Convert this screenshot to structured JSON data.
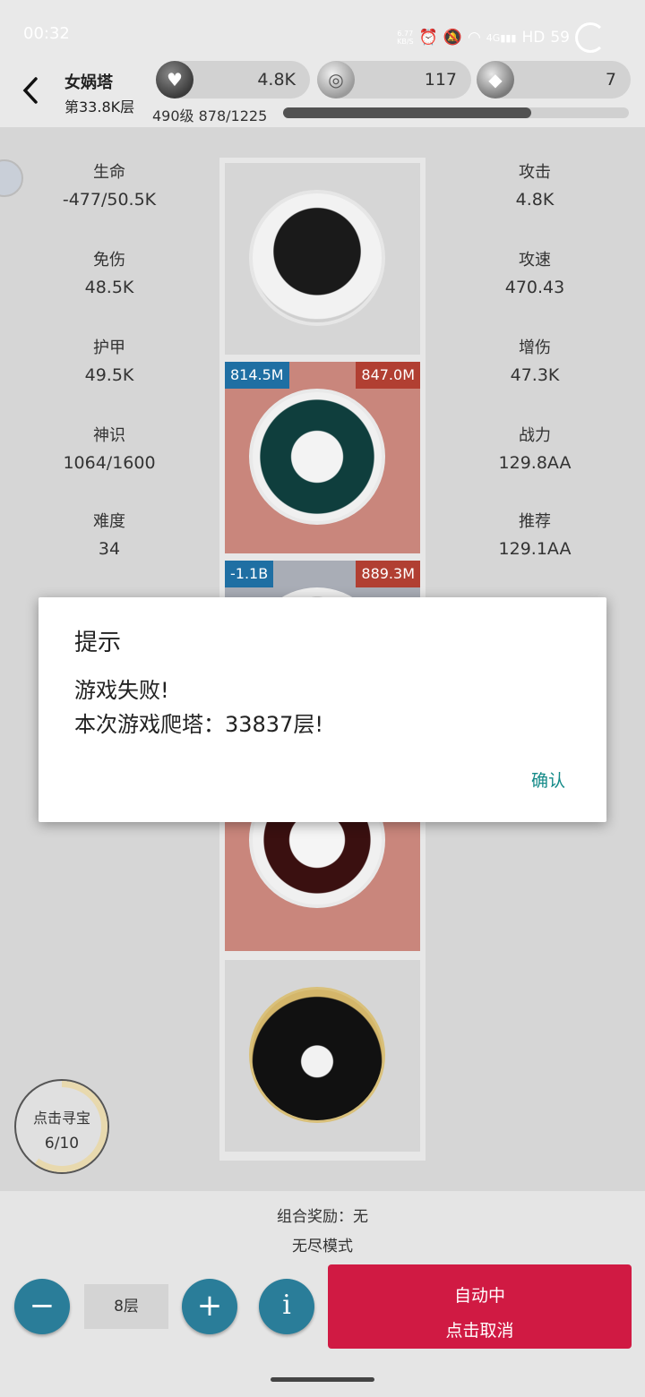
{
  "status_bar": {
    "time": "00:32",
    "net_speed_value": "6.77",
    "net_speed_unit": "KB/S",
    "signal_label": "4G",
    "hd_label": "HD",
    "battery": "59"
  },
  "header": {
    "title": "女娲塔",
    "floor_label": "第33.8K层",
    "resources": [
      {
        "icon": "heart-icon",
        "value": "4.8K"
      },
      {
        "icon": "coin-icon",
        "value": "117"
      },
      {
        "icon": "diamond-icon",
        "value": "7"
      }
    ],
    "level_text": "490级 878/1225",
    "xp_progress": 0.717
  },
  "stats_left": [
    {
      "label": "生命",
      "value": "-477/50.5K"
    },
    {
      "label": "免伤",
      "value": "48.5K"
    },
    {
      "label": "护甲",
      "value": "49.5K"
    },
    {
      "label": "神识",
      "value": "1064/1600"
    },
    {
      "label": "难度",
      "value": "34"
    }
  ],
  "stats_right": [
    {
      "label": "攻击",
      "value": "4.8K"
    },
    {
      "label": "攻速",
      "value": "470.43"
    },
    {
      "label": "增伤",
      "value": "47.3K"
    },
    {
      "label": "战力",
      "value": "129.8AA"
    },
    {
      "label": "推荐",
      "value": "129.1AA"
    }
  ],
  "tower_cells": [
    {
      "tag_left": "",
      "tag_right": ""
    },
    {
      "tag_left": "814.5M",
      "tag_right": "847.0M"
    },
    {
      "tag_left": "-1.1B",
      "tag_right": "889.3M"
    }
  ],
  "treasure": {
    "label": "点击寻宝",
    "count": "6/10",
    "progress": 0.6
  },
  "bottom": {
    "combo_reward": "组合奖励：无",
    "mode": "无尽模式",
    "floors": "8层",
    "minus": "−",
    "plus": "+",
    "info": "i",
    "auto_line1": "自动中",
    "auto_line2": "点击取消"
  },
  "dialog": {
    "title": "提示",
    "line1": "游戏失败!",
    "line2": "本次游戏爬塔：33837层!",
    "confirm": "确认"
  },
  "colors": {
    "accent_blue": "#2a7d99",
    "auto_red": "#d01a43",
    "cell_red": "#c9867c",
    "tag_blue": "#1f6fa3",
    "tag_red": "#b13f32",
    "confirm_teal": "#138a88"
  }
}
